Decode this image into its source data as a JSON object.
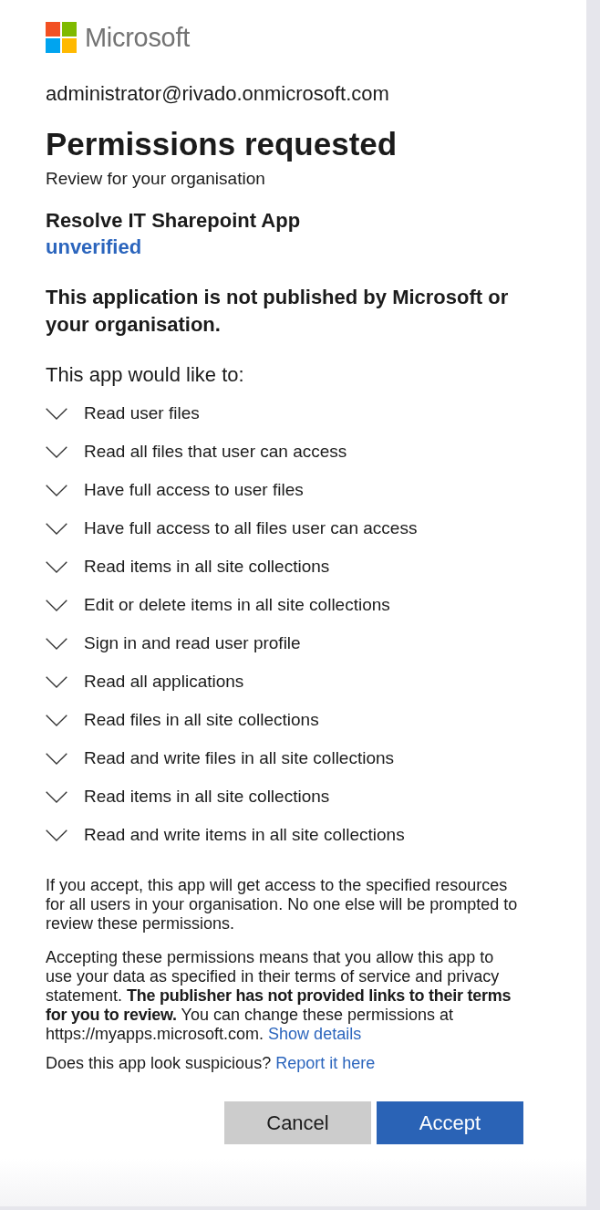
{
  "header": {
    "brand": "Microsoft"
  },
  "account": {
    "email": "administrator@rivado.onmicrosoft.com"
  },
  "title": "Permissions requested",
  "subtitle": "Review for your organisation",
  "app": {
    "name": "Resolve IT Sharepoint App",
    "publisher_status": "unverified"
  },
  "warning": "This application is not published by Microsoft or your organisation.",
  "permissions": {
    "heading": "This app would like to:",
    "items": [
      {
        "label": "Read user files",
        "expanded": false
      },
      {
        "label": "Read all files that user can access",
        "expanded": false
      },
      {
        "label": "Have full access to user files",
        "expanded": false
      },
      {
        "label": "Have full access to all files user can access",
        "expanded": false
      },
      {
        "label": "Read items in all site collections",
        "expanded": false
      },
      {
        "label": "Edit or delete items in all site collections",
        "expanded": false
      },
      {
        "label": "Sign in and read user profile",
        "expanded": false
      },
      {
        "label": "Read all applications",
        "expanded": false
      },
      {
        "label": "Read files in all site collections",
        "expanded": false
      },
      {
        "label": "Read and write files in all site collections",
        "expanded": false
      },
      {
        "label": "Read items in all site collections",
        "expanded": false
      },
      {
        "label": "Read and write items in all site collections",
        "expanded": false
      }
    ]
  },
  "notices": [
    {
      "text": "If you accept, this app will get access to the specified resources for all users in your organisation. No one else will be prompted to review these permissions."
    },
    {
      "text": "Accepting these permissions means that you allow this app to use your data as specified in their terms of service and privacy statement. **The publisher has not provided links to their terms for you to review.** You can change these permissions at https://myapps.microsoft.com.",
      "link": "Show details"
    }
  ],
  "suspicious": {
    "text": "Does this app look suspicious?",
    "link": "Report it here"
  },
  "buttons": [
    {
      "label": "Cancel",
      "kind": "secondary"
    },
    {
      "label": "Accept",
      "kind": "primary"
    }
  ]
}
